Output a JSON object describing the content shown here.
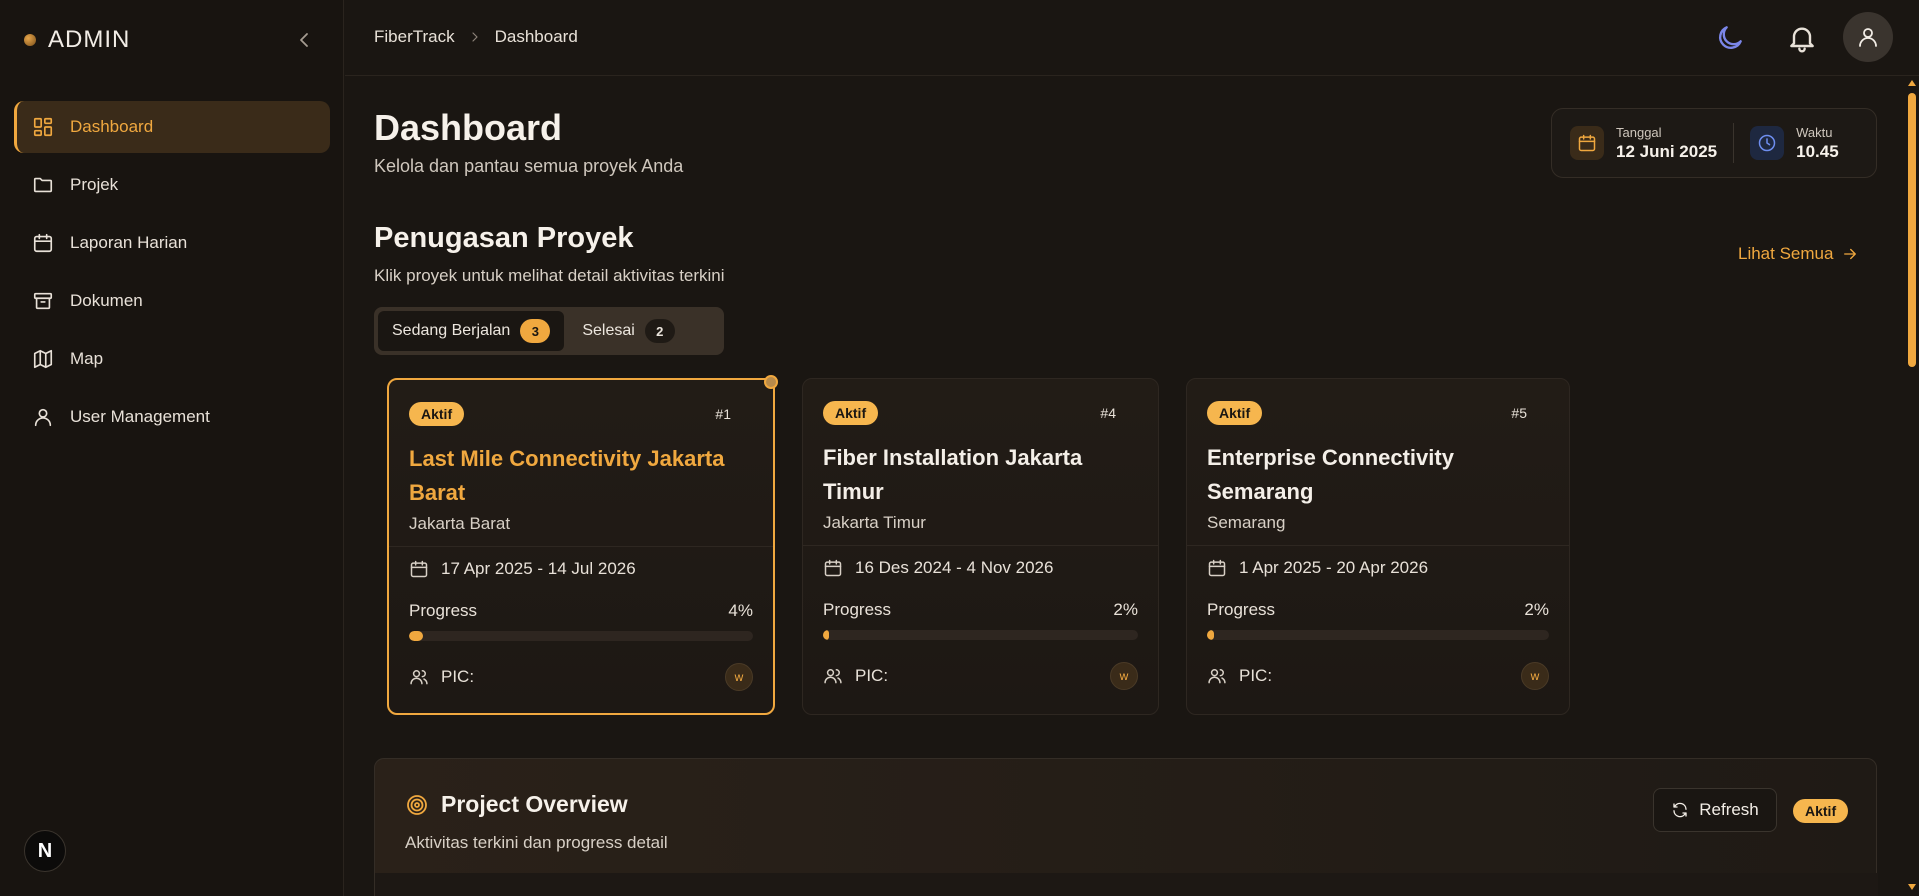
{
  "app": {
    "brand": "ADMIN"
  },
  "sidebar": {
    "items": [
      {
        "label": "Dashboard",
        "icon": "dashboard-icon",
        "active": true
      },
      {
        "label": "Projek",
        "icon": "folder-icon"
      },
      {
        "label": "Laporan Harian",
        "icon": "calendar-icon"
      },
      {
        "label": "Dokumen",
        "icon": "archive-icon"
      },
      {
        "label": "Map",
        "icon": "map-icon"
      },
      {
        "label": "User Management",
        "icon": "user-icon"
      }
    ],
    "footer_badge": "N"
  },
  "header": {
    "breadcrumb": [
      "FiberTrack",
      "Dashboard"
    ]
  },
  "page": {
    "title": "Dashboard",
    "subtitle": "Kelola dan pantau semua proyek Anda"
  },
  "datetime": {
    "date_label": "Tanggal",
    "date_value": "12 Juni 2025",
    "time_label": "Waktu",
    "time_value": "10.45"
  },
  "assignments": {
    "title": "Penugasan Proyek",
    "subtitle": "Klik proyek untuk melihat detail aktivitas terkini",
    "see_all": "Lihat Semua",
    "tabs": [
      {
        "label": "Sedang Berjalan",
        "count": "3"
      },
      {
        "label": "Selesai",
        "count": "2"
      }
    ],
    "progress_label": "Progress",
    "pic_label": "PIC:",
    "cards": [
      {
        "status": "Aktif",
        "id": "#1",
        "title": "Last Mile Connectivity Jakarta Barat",
        "location": "Jakarta Barat",
        "dates": "17 Apr 2025 - 14 Jul 2026",
        "progress": 4,
        "progress_text": "4%",
        "pic_initial": "w"
      },
      {
        "status": "Aktif",
        "id": "#4",
        "title": "Fiber Installation Jakarta Timur",
        "location": "Jakarta Timur",
        "dates": "16 Des 2024 - 4 Nov 2026",
        "progress": 2,
        "progress_text": "2%",
        "pic_initial": "w"
      },
      {
        "status": "Aktif",
        "id": "#5",
        "title": "Enterprise Connectivity Semarang",
        "location": "Semarang",
        "dates": "1 Apr 2025 - 20 Apr 2026",
        "progress": 2,
        "progress_text": "2%",
        "pic_initial": "w"
      }
    ]
  },
  "overview": {
    "title": "Project Overview",
    "subtitle": "Aktivitas terkini dan progress detail",
    "refresh_label": "Refresh",
    "status": "Aktif"
  },
  "colors": {
    "accent": "#f0a83f",
    "background": "#1a1612",
    "moon": "#7b86e8"
  }
}
